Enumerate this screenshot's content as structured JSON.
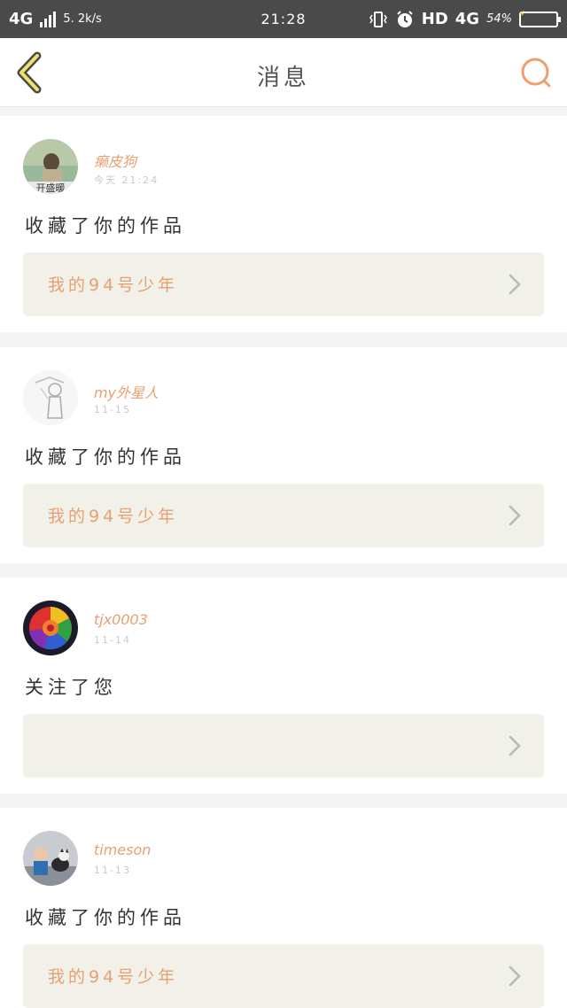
{
  "status_bar": {
    "network": "4G",
    "speed": "5. 2k/s",
    "time": "21:28",
    "hd": "HD",
    "net_right": "4G",
    "battery": "54%"
  },
  "header": {
    "title": "消息",
    "accent_color": "#e8a070"
  },
  "messages": [
    {
      "username": "癞皮狗",
      "time": "今天 21:24",
      "action": "收藏了你的作品",
      "work_title": "我的94号少年",
      "avatar": "avatar-photo-woman"
    },
    {
      "username": "my外星人",
      "time": "11-15",
      "action": "收藏了你的作品",
      "work_title": "我的94号少年",
      "avatar": "avatar-sketch"
    },
    {
      "username": "tjx0003",
      "time": "11-14",
      "action": "关注了您",
      "work_title": "",
      "avatar": "avatar-rainbow-rose"
    },
    {
      "username": "timeson",
      "time": "11-13",
      "action": "收藏了你的作品",
      "work_title": "我的94号少年",
      "avatar": "avatar-child-dog"
    }
  ]
}
